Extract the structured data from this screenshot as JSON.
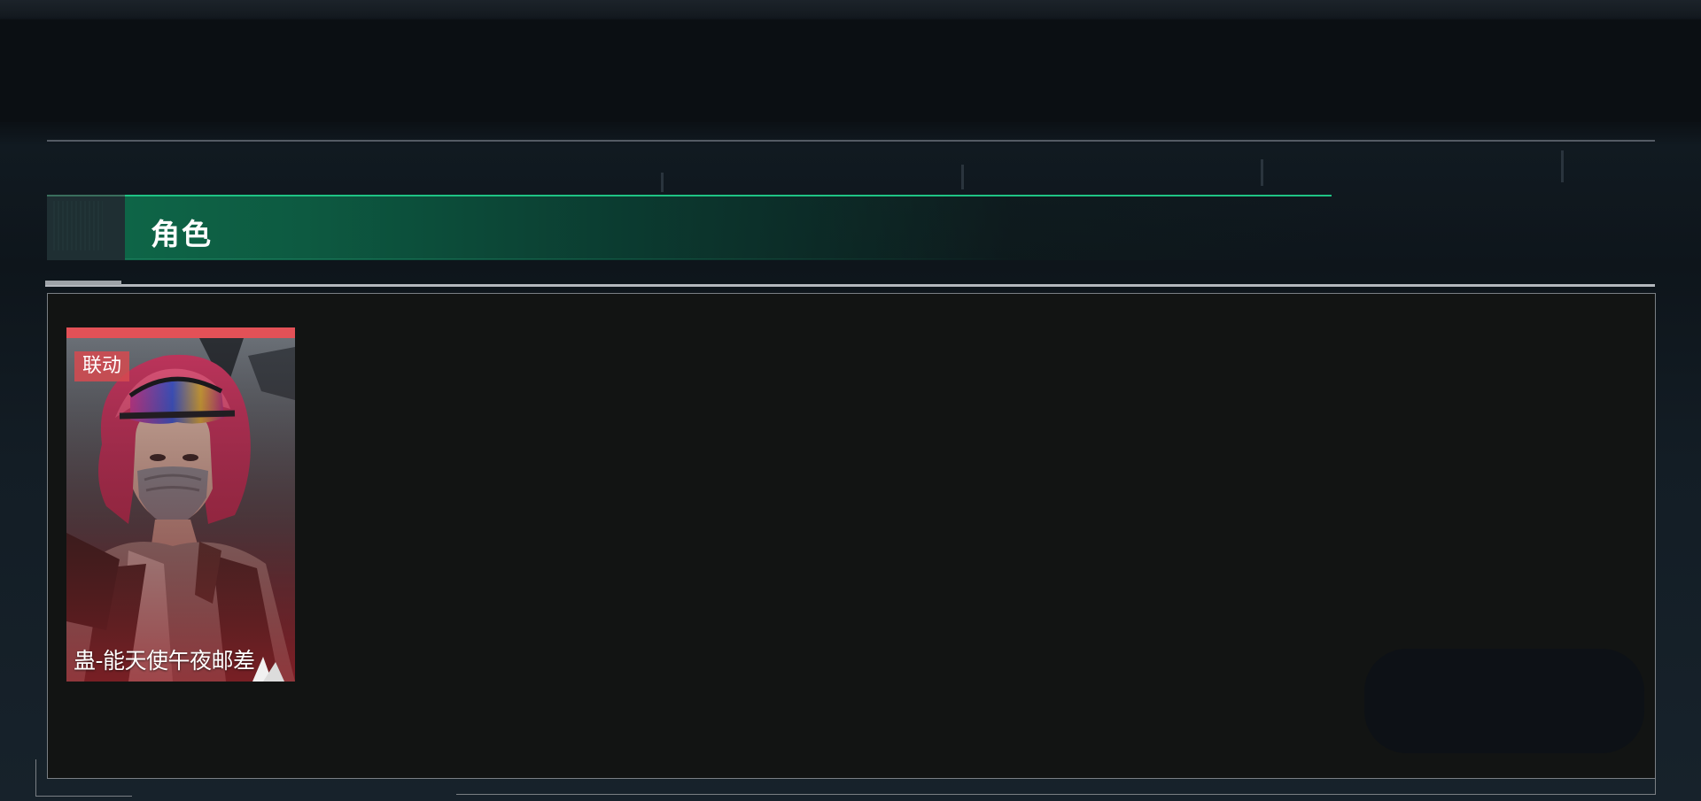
{
  "section": {
    "title": "角色"
  },
  "characters": [
    {
      "badge": "联动",
      "name": "蛊-能天使午夜邮差"
    }
  ],
  "colors": {
    "accent_green": "#1fc384",
    "badge_red": "#e35157",
    "panel_bg": "#121413"
  }
}
